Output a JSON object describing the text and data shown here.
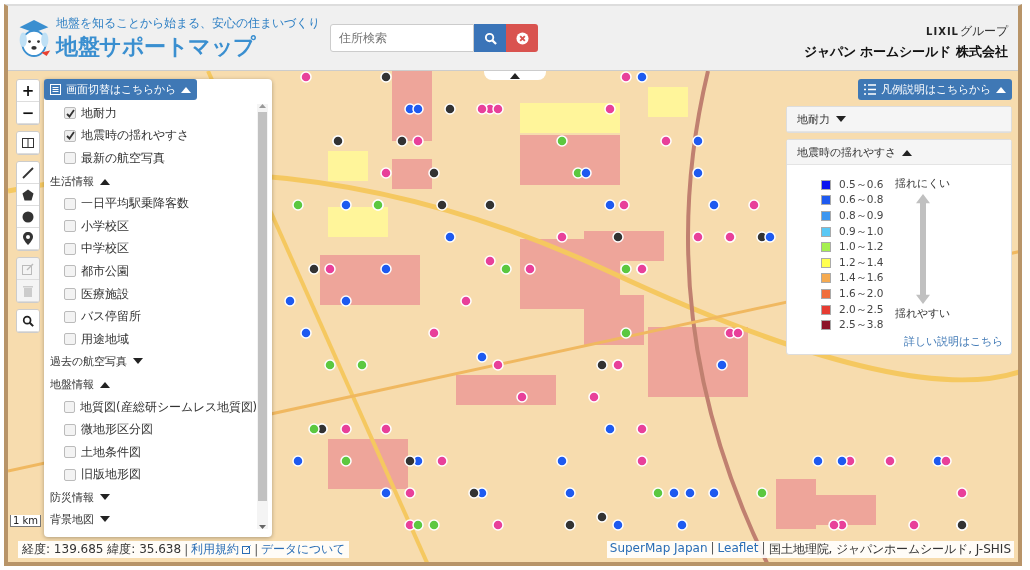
{
  "header": {
    "tagline": "地盤を知ることから始まる、安心の住まいづくり",
    "title": "地盤サポートマップ",
    "search": {
      "placeholder": "住所検索"
    },
    "group_logo": "LIXIL",
    "group_suffix": "グループ",
    "company": "ジャパン ホームシールド 株式会社"
  },
  "map_tools": {
    "zoom_in": "+",
    "zoom_out": "−"
  },
  "layer_panel": {
    "toggle": "画面切替はこちらから",
    "expanded": true,
    "sections": [
      {
        "items": [
          {
            "label": "地耐力",
            "checked": true
          },
          {
            "label": "地震時の揺れやすさ",
            "checked": true
          },
          {
            "label": "最新の航空写真",
            "checked": false
          }
        ]
      },
      {
        "title": "生活情報",
        "expanded": true,
        "items": [
          {
            "label": "一日平均駅乗降客数",
            "checked": false
          },
          {
            "label": "小学校区",
            "checked": false
          },
          {
            "label": "中学校区",
            "checked": false
          },
          {
            "label": "都市公園",
            "checked": false
          },
          {
            "label": "医療施設",
            "checked": false
          },
          {
            "label": "バス停留所",
            "checked": false
          },
          {
            "label": "用途地域",
            "checked": false
          }
        ]
      },
      {
        "title": "過去の航空写真",
        "expanded": false
      },
      {
        "title": "地盤情報",
        "expanded": true,
        "items": [
          {
            "label": "地質図(産総研シームレス地質図)",
            "checked": false
          },
          {
            "label": "微地形区分図",
            "checked": false
          },
          {
            "label": "土地条件図",
            "checked": false
          },
          {
            "label": "旧版地形図",
            "checked": false
          }
        ]
      },
      {
        "title": "防災情報",
        "expanded": false
      },
      {
        "title": "背景地図",
        "expanded": false
      }
    ]
  },
  "legend": {
    "toggle": "凡例説明はこちらから",
    "expanded": true,
    "panels": [
      {
        "title": "地耐力",
        "expanded": false
      },
      {
        "title": "地震時の揺れやすさ",
        "expanded": true,
        "top_label": "揺れにくい",
        "bottom_label": "揺れやすい",
        "link": "詳しい説明はこちら",
        "entries": [
          {
            "label": "0.5～0.6",
            "color": "#0a14f0"
          },
          {
            "label": "0.6～0.8",
            "color": "#1e5af0"
          },
          {
            "label": "0.8～0.9",
            "color": "#3c96f0"
          },
          {
            "label": "0.9～1.0",
            "color": "#5ac8f5"
          },
          {
            "label": "1.0～1.2",
            "color": "#a5f050"
          },
          {
            "label": "1.2～1.4",
            "color": "#ffff50"
          },
          {
            "label": "1.4～1.6",
            "color": "#f5aa50"
          },
          {
            "label": "1.6～2.0",
            "color": "#f06e3c"
          },
          {
            "label": "2.0～2.5",
            "color": "#e63c32"
          },
          {
            "label": "2.5～3.8",
            "color": "#8c1428"
          }
        ]
      }
    ]
  },
  "scale": "1 km",
  "coordinates": {
    "text": "経度: 139.685 緯度: 35.638",
    "separator": "|",
    "terms_link": "利用規約",
    "data_link": "データについて"
  },
  "attribution": {
    "links": [
      "SuperMap Japan",
      "Leaflet"
    ],
    "separator": "|",
    "text": "国土地理院, ジャパンホームシールド, J-SHIS"
  }
}
